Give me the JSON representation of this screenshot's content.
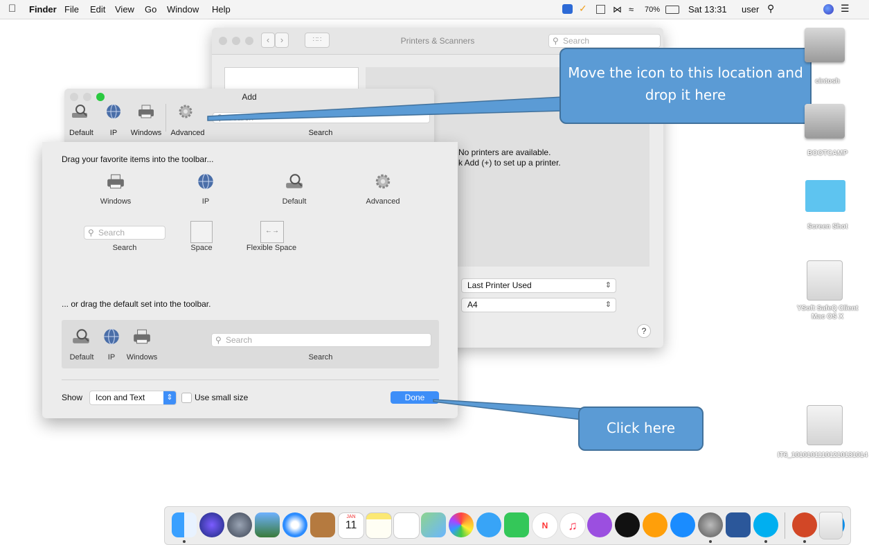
{
  "menubar": {
    "app_name": "Finder",
    "items": [
      "File",
      "Edit",
      "View",
      "Go",
      "Window",
      "Help"
    ],
    "battery": "70%",
    "clock": "Sat 13:31",
    "user": "user"
  },
  "printers_window": {
    "title": "Printers & Scanners",
    "search_placeholder": "Search",
    "no_printers_line1": "No printers are available.",
    "no_printers_line2": "k Add (+) to set up a printer.",
    "default_printer_value": "Last Printer Used",
    "paper_size_value": "A4",
    "help_label": "?"
  },
  "add_window": {
    "title": "Add",
    "toolbar": [
      {
        "label": "Default",
        "icon": "printer-magnifier-icon"
      },
      {
        "label": "IP",
        "icon": "globe-icon"
      },
      {
        "label": "Windows",
        "icon": "printer-icon"
      },
      {
        "label": "Advanced",
        "icon": "gear-icon"
      }
    ],
    "search_placeholder": "Search",
    "search_label": "Search"
  },
  "customize_sheet": {
    "drag_hint": "Drag your favorite items into the toolbar...",
    "items": [
      {
        "label": "Windows",
        "icon": "printer-icon"
      },
      {
        "label": "IP",
        "icon": "globe-icon"
      },
      {
        "label": "Default",
        "icon": "printer-magnifier-icon"
      },
      {
        "label": "Advanced",
        "icon": "gear-icon"
      }
    ],
    "search_placeholder": "Search",
    "search_label": "Search",
    "space_label": "Space",
    "flexible_space_label": "Flexible Space",
    "default_set_hint": "... or drag the default set into the toolbar.",
    "default_set": [
      {
        "label": "Default",
        "icon": "printer-magnifier-icon"
      },
      {
        "label": "IP",
        "icon": "globe-icon"
      },
      {
        "label": "Windows",
        "icon": "printer-icon"
      }
    ],
    "default_set_search_placeholder": "Search",
    "default_set_search_label": "Search",
    "show_label": "Show",
    "show_value": "Icon and Text",
    "small_size_label": "Use small size",
    "done_label": "Done"
  },
  "callouts": {
    "move_icon": "Move the icon to this location and drop it here",
    "click_here": "Click here"
  },
  "desktop": [
    {
      "label": "cintosh",
      "icon": "hard-drive-icon"
    },
    {
      "label": "BOOTCAMP",
      "icon": "hard-drive-icon"
    },
    {
      "label": "Screen Shot",
      "icon": "folder-icon"
    },
    {
      "label": "YSoft SafeQ Client Mac OS X",
      "icon": "external-drive-icon"
    },
    {
      "label": "IT6_10101011101210131014",
      "icon": "external-drive-icon"
    }
  ],
  "dock_calendar": {
    "month": "JAN",
    "day": "11"
  },
  "colors": {
    "callout_fill": "#5b9bd5",
    "callout_border": "#41719c",
    "done_button": "#3d8ef8",
    "accent": "#3d8ef8"
  }
}
